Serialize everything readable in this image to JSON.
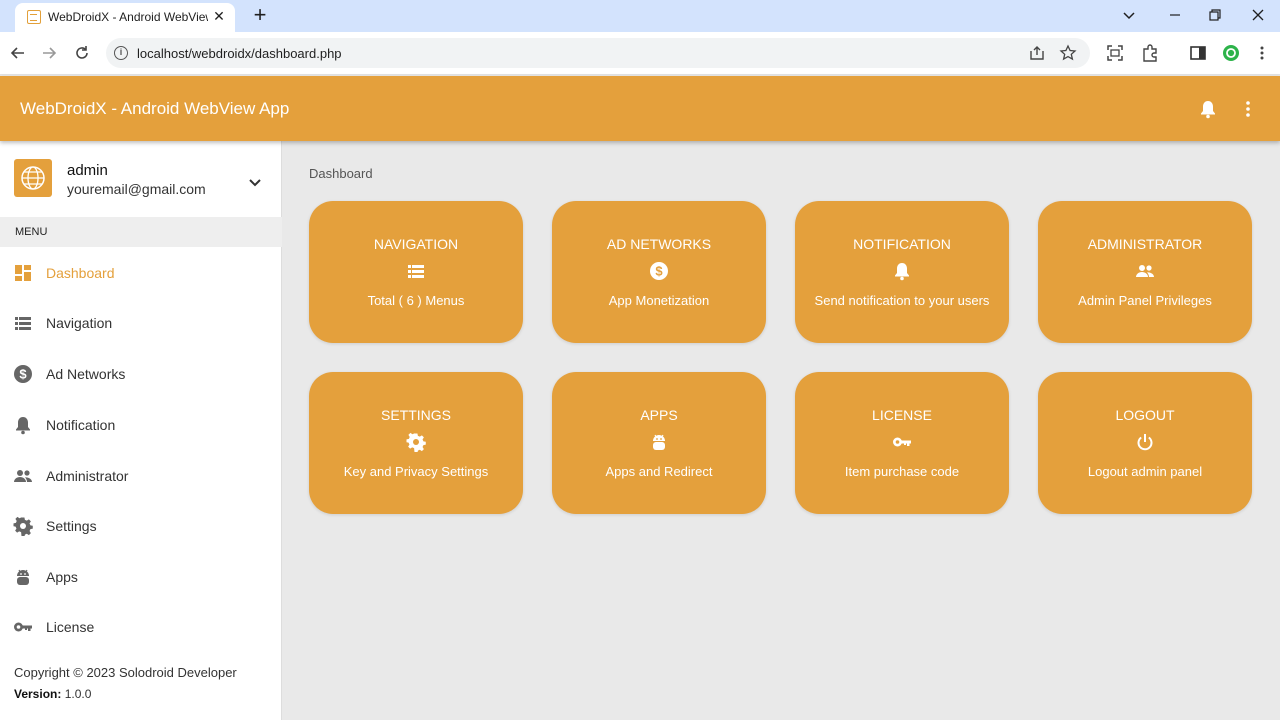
{
  "browser": {
    "tab_title": "WebDroidX - Android WebView",
    "url": "localhost/webdroidx/dashboard.php"
  },
  "app": {
    "title": "WebDroidX - Android WebView App",
    "accent_color": "#e4a03c"
  },
  "user": {
    "name": "admin",
    "email": "youremail@gmail.com"
  },
  "sidebar": {
    "menu_header": "MENU",
    "items": [
      {
        "label": "Dashboard",
        "icon": "dashboard-icon",
        "active": true
      },
      {
        "label": "Navigation",
        "icon": "list-icon"
      },
      {
        "label": "Ad Networks",
        "icon": "dollar-icon"
      },
      {
        "label": "Notification",
        "icon": "bell-icon"
      },
      {
        "label": "Administrator",
        "icon": "people-icon"
      },
      {
        "label": "Settings",
        "icon": "gear-icon"
      },
      {
        "label": "Apps",
        "icon": "android-icon"
      },
      {
        "label": "License",
        "icon": "key-icon"
      }
    ],
    "copyright": "Copyright © 2023 Solodroid Developer",
    "version_label": "Version:",
    "version_value": "1.0.0"
  },
  "main": {
    "breadcrumb": "Dashboard",
    "cards": [
      {
        "title": "NAVIGATION",
        "subtitle": "Total ( 6 ) Menus",
        "icon": "list-icon"
      },
      {
        "title": "AD NETWORKS",
        "subtitle": "App Monetization",
        "icon": "dollar-icon"
      },
      {
        "title": "NOTIFICATION",
        "subtitle": "Send notification to your users",
        "icon": "bell-icon"
      },
      {
        "title": "ADMINISTRATOR",
        "subtitle": "Admin Panel Privileges",
        "icon": "people-icon"
      },
      {
        "title": "SETTINGS",
        "subtitle": "Key and Privacy Settings",
        "icon": "gear-icon"
      },
      {
        "title": "APPS",
        "subtitle": "Apps and Redirect",
        "icon": "android-icon"
      },
      {
        "title": "LICENSE",
        "subtitle": "Item purchase code",
        "icon": "key-icon"
      },
      {
        "title": "LOGOUT",
        "subtitle": "Logout admin panel",
        "icon": "power-icon"
      }
    ]
  }
}
